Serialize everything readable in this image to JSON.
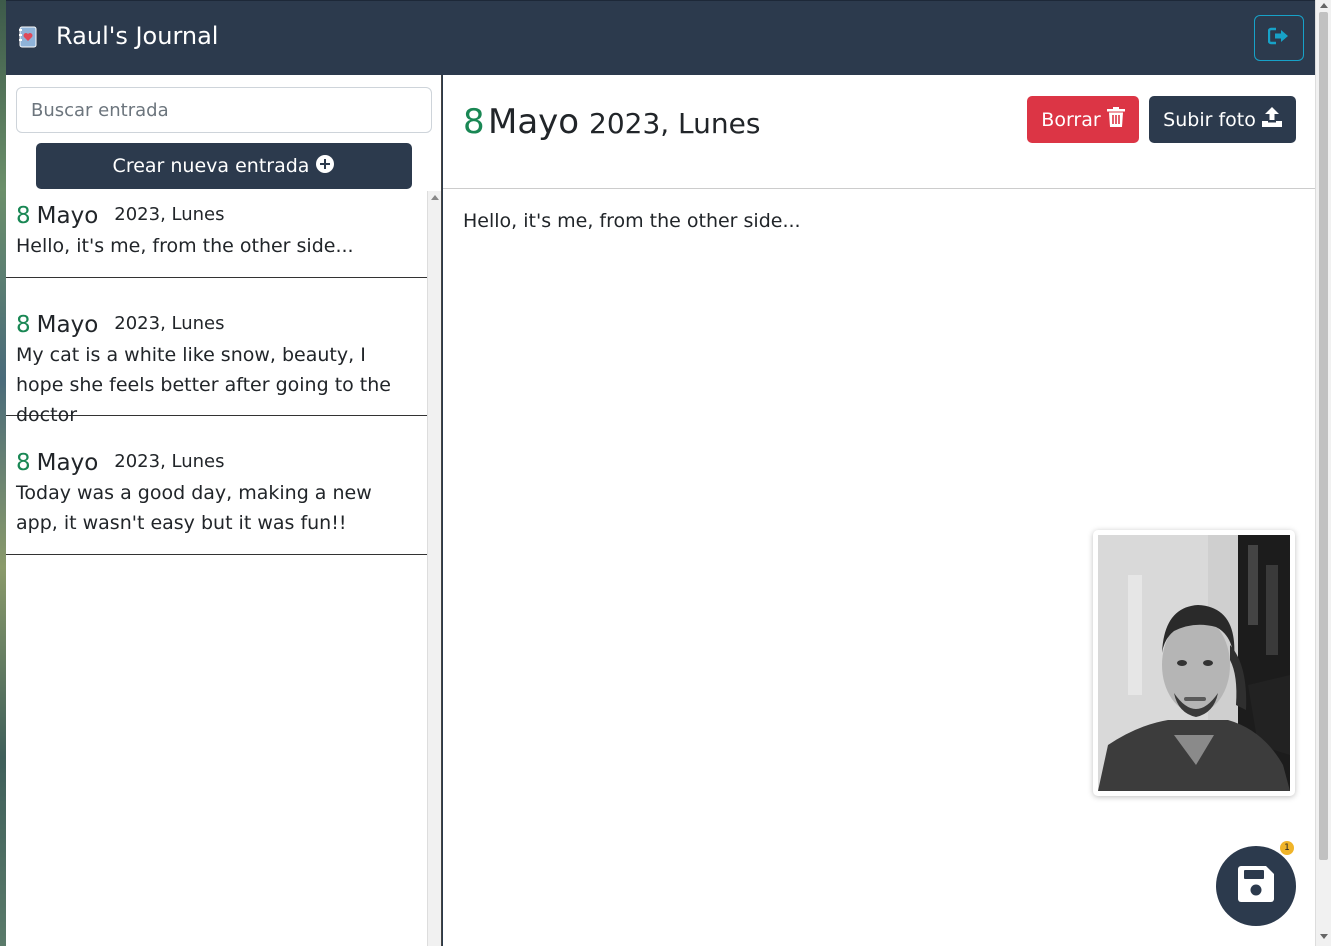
{
  "app": {
    "title": "Raul's Journal",
    "logout_icon": "logout-icon",
    "accent_color": "#17a2c8",
    "nav_color": "#2c3a4d"
  },
  "sidebar": {
    "search_placeholder": "Buscar entrada",
    "search_value": "",
    "new_entry_label": "Crear nueva entrada",
    "entries": [
      {
        "day": "8",
        "month": "Mayo",
        "year_weekday": "2023, Lunes",
        "text": "Hello, it's me, from the other side..."
      },
      {
        "day": "8",
        "month": "Mayo",
        "year_weekday": "2023, Lunes",
        "text": "My cat is a white like snow, beauty, I hope she feels better after going to the doctor"
      },
      {
        "day": "8",
        "month": "Mayo",
        "year_weekday": "2023, Lunes",
        "text": "Today was a good day, making a new app, it wasn't easy but it was fun!!"
      }
    ]
  },
  "main": {
    "day": "8",
    "month": "Mayo",
    "year_weekday": "2023, Lunes",
    "delete_label": "Borrar",
    "upload_label": "Subir foto",
    "body_text": "Hello, it's me, from the other side...",
    "delete_color": "#dc3545",
    "day_color": "#198754"
  },
  "fab": {
    "icon": "save-icon",
    "badge": "1"
  }
}
